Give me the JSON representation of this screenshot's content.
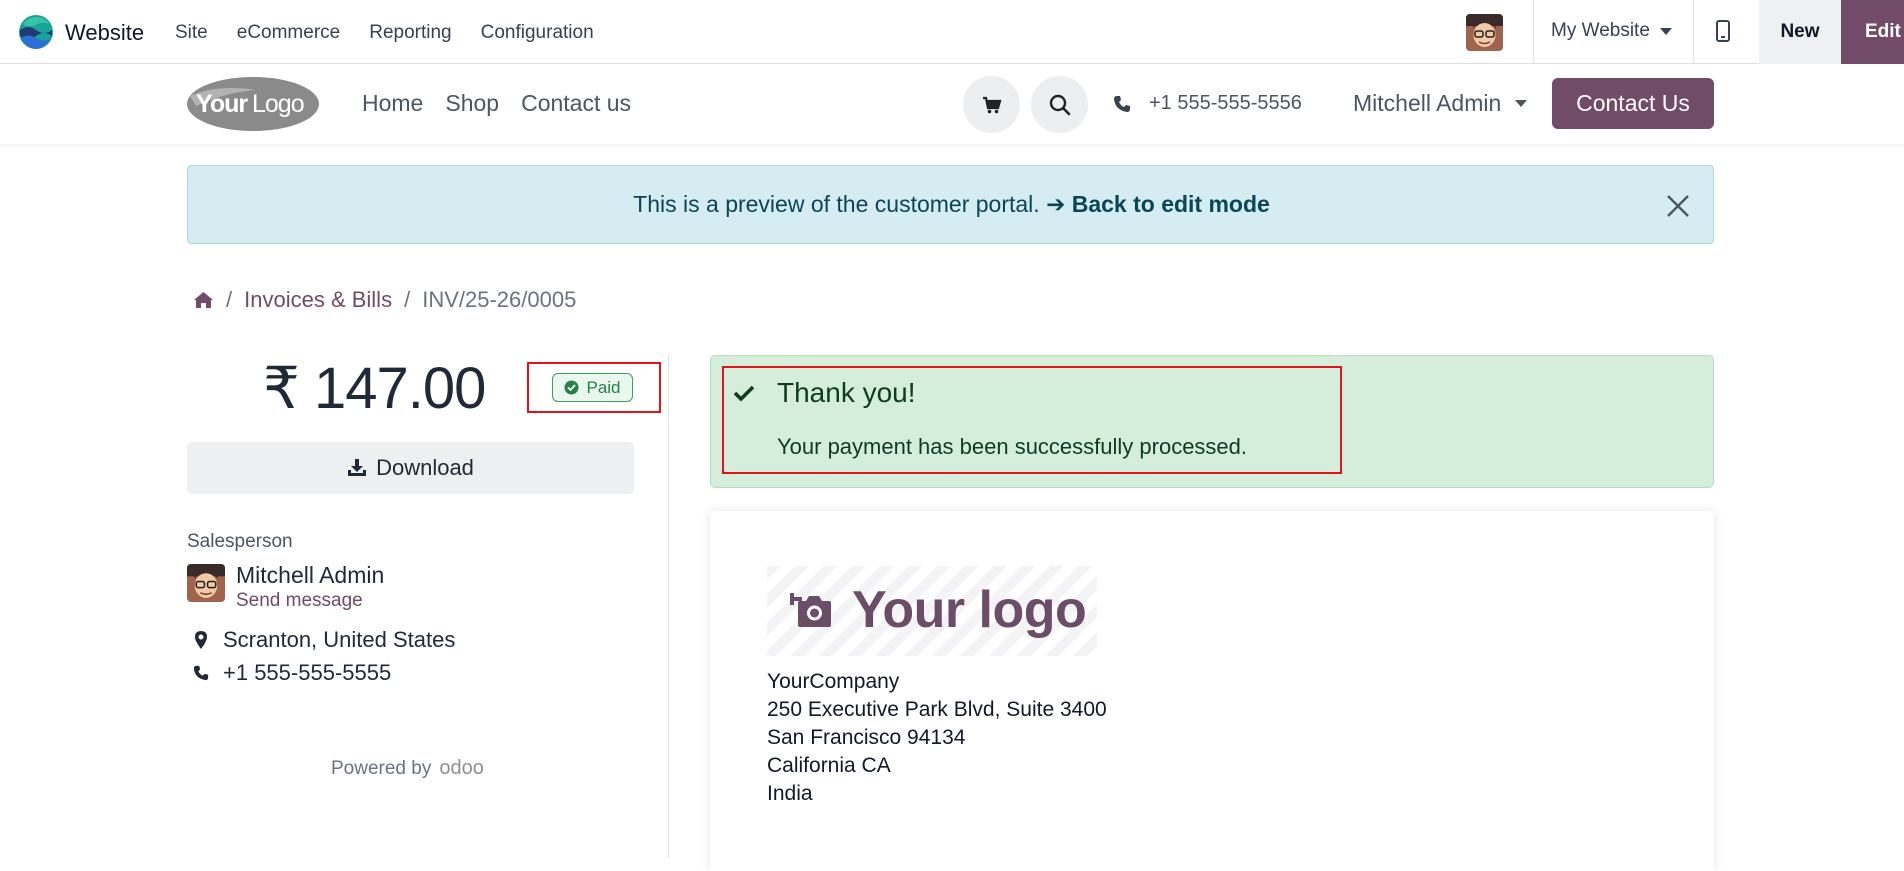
{
  "admin_bar": {
    "app_name": "Website",
    "menu": [
      "Site",
      "eCommerce",
      "Reporting",
      "Configuration"
    ],
    "website_selector": "My Website",
    "new_label": "New",
    "edit_label": "Edit"
  },
  "site_header": {
    "logo_text": "YourLogo",
    "nav": [
      "Home",
      "Shop",
      "Contact us"
    ],
    "phone": "+1 555-555-5556",
    "user": "Mitchell Admin",
    "contact_button": "Contact Us"
  },
  "preview_alert": {
    "text": "This is a preview of the customer portal.",
    "link": "➔ Back to edit mode"
  },
  "breadcrumb": {
    "items": [
      "Invoices & Bills",
      "INV/25-26/0005"
    ]
  },
  "invoice_summary": {
    "amount": "₹ 147.00",
    "status": "Paid",
    "download_label": "Download"
  },
  "salesperson": {
    "label": "Salesperson",
    "name": "Mitchell Admin",
    "send_message": "Send message",
    "location": "Scranton, United States",
    "phone": "+1 555-555-5555"
  },
  "footer": {
    "powered_by": "Powered by",
    "brand": "odoo"
  },
  "success_alert": {
    "title": "Thank you!",
    "message": "Your payment has been successfully processed."
  },
  "invoice_document": {
    "logo_placeholder": "Your logo",
    "company_address": [
      "YourCompany",
      "250 Executive Park Blvd, Suite 3400",
      "San Francisco 94134",
      "California CA",
      "India"
    ]
  },
  "colors": {
    "brand": "#714b67",
    "highlight": "#e3121b",
    "success_bg": "#d5eddb",
    "info_bg": "#d4ecf2"
  }
}
